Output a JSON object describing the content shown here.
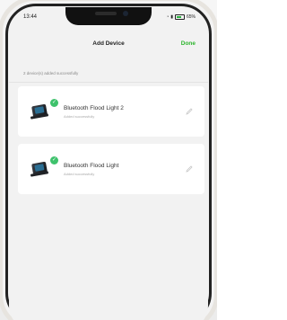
{
  "status_bar": {
    "time": "13:44",
    "battery": "65%"
  },
  "nav": {
    "title": "Add Device",
    "done_label": "Done"
  },
  "info": {
    "added_count_text": "2 device(s) added successfully"
  },
  "devices": [
    {
      "name": "Bluetooth Flood Light 2",
      "status": "Added successfully"
    },
    {
      "name": "Bluetooth Flood Light",
      "status": "Added successfully"
    }
  ],
  "colors": {
    "accent_green": "#2eb52e",
    "check_badge": "#3ec26c"
  },
  "icons": {
    "check": "check-icon",
    "edit": "edit-pencil-icon",
    "device": "flood-light-icon"
  }
}
